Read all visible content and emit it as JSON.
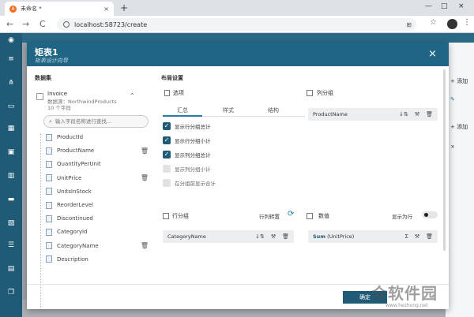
{
  "browser": {
    "tab_title": "未命名 *",
    "tab_close": "×",
    "new_tab": "+",
    "url": "localhost:58723/create",
    "back": "←",
    "forward": "→",
    "reload": "C",
    "win_min": "—",
    "win_max": "□",
    "win_close": "×"
  },
  "dialog": {
    "title": "矩表1",
    "subtitle": "矩表设计向导",
    "close": "×"
  },
  "dataset": {
    "heading": "数据集",
    "name": "Invoice",
    "source": "数据源：NorthwindProducts",
    "count": "10 个字段",
    "search_placeholder": "输入字段名称进行查找...",
    "fields": [
      {
        "name": "ProductId",
        "trash": false
      },
      {
        "name": "ProductName",
        "trash": true
      },
      {
        "name": "QuantityPerUnit",
        "trash": false
      },
      {
        "name": "UnitPrice",
        "trash": true
      },
      {
        "name": "UnitsInStock",
        "trash": false
      },
      {
        "name": "ReorderLevel",
        "trash": false
      },
      {
        "name": "Discontinued",
        "trash": false
      },
      {
        "name": "CategoryId",
        "trash": false
      },
      {
        "name": "CategoryName",
        "trash": true
      },
      {
        "name": "Description",
        "trash": false
      }
    ]
  },
  "layout": {
    "heading": "布局设置",
    "options_label": "选项",
    "tabs": [
      "汇总",
      "样式",
      "结构"
    ],
    "checkboxes": [
      {
        "label": "显示行分组总计",
        "checked": true
      },
      {
        "label": "显示行分组小计",
        "checked": true
      },
      {
        "label": "显示列分组总计",
        "checked": true
      },
      {
        "label": "显示列分组小计",
        "checked": false
      },
      {
        "label": "在分组前显示合计",
        "checked": false
      }
    ],
    "column_group_label": "列分组",
    "column_group_item": "ProductName",
    "row_group_label": "行分组",
    "row_group_swap": "行列转置",
    "row_group_item": "CategoryName",
    "values_label": "数值",
    "values_show_as_rows": "显示为行",
    "values_item_func": "Sum",
    "values_item_field": "(UnitPrice)"
  },
  "footer": {
    "ok": "确定"
  },
  "background_peek": {
    "add1": "添加",
    "add2": "添加"
  },
  "watermark": {
    "text": "众软件园",
    "url": "www.hezhong.net"
  }
}
